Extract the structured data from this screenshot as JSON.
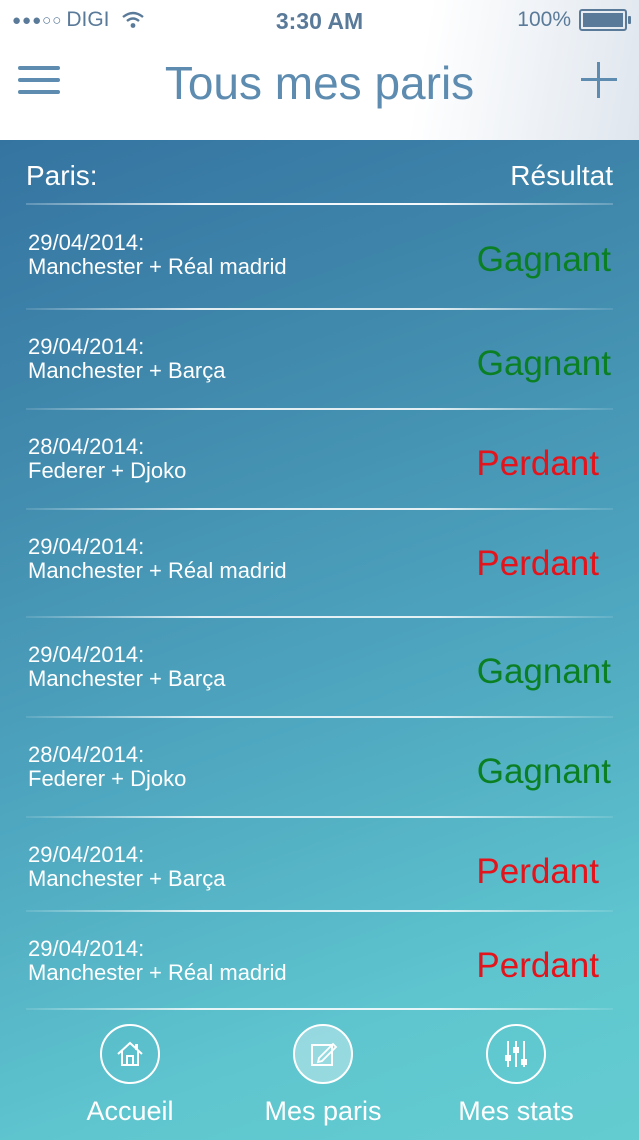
{
  "status_bar": {
    "signal": "●●●○○",
    "carrier": "DIGI",
    "time": "3:30 AM",
    "battery": "100%",
    "battery_level": 1.0
  },
  "header": {
    "title": "Tous mes paris"
  },
  "list": {
    "col_paris": "Paris:",
    "col_resultat": "Résultat",
    "rows": [
      {
        "date": "29/04/2014:",
        "match": "Manchester + Réal madrid",
        "result": "Gagnant",
        "status": "won"
      },
      {
        "date": "29/04/2014:",
        "match": "Manchester + Barça",
        "result": "Gagnant",
        "status": "won"
      },
      {
        "date": "28/04/2014:",
        "match": "Federer + Djoko",
        "result": "Perdant",
        "status": "lost"
      },
      {
        "date": "29/04/2014:",
        "match": "Manchester + Réal madrid",
        "result": "Perdant",
        "status": "lost"
      },
      {
        "date": "29/04/2014:",
        "match": "Manchester + Barça",
        "result": "Gagnant",
        "status": "won"
      },
      {
        "date": "28/04/2014:",
        "match": "Federer + Djoko",
        "result": "Gagnant",
        "status": "won"
      },
      {
        "date": "29/04/2014:",
        "match": "Manchester + Barça",
        "result": "Perdant",
        "status": "lost"
      },
      {
        "date": "29/04/2014:",
        "match": "Manchester + Réal madrid",
        "result": "Perdant",
        "status": "lost"
      }
    ]
  },
  "tabbar": {
    "tabs": [
      {
        "label": "Accueil",
        "icon": "home-icon",
        "active": false
      },
      {
        "label": "Mes paris",
        "icon": "edit-icon",
        "active": true
      },
      {
        "label": "Mes stats",
        "icon": "sliders-icon",
        "active": false
      }
    ]
  },
  "colors": {
    "won": "#0b7f23",
    "lost": "#e3141b",
    "header_text": "#5d8cb0"
  }
}
